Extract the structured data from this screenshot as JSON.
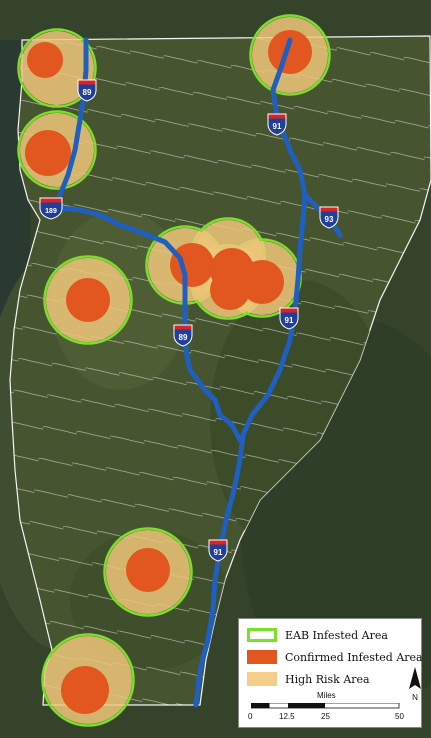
{
  "map": {
    "colors": {
      "background": "#3b4a2c",
      "state_fill": "#4a5a34",
      "town_lines": "#f2f2f2",
      "highway": "#1f5fbf",
      "highway_in_risk": "#9aa0a8",
      "confirmed": "#e2571f",
      "high_risk": "#f0c77a",
      "eab_border": "#7be02a"
    },
    "interstate_shields": [
      {
        "id": "shield-89-north",
        "number": "89"
      },
      {
        "id": "shield-91-north",
        "number": "91"
      },
      {
        "id": "shield-189",
        "number": "189"
      },
      {
        "id": "shield-93",
        "number": "93"
      },
      {
        "id": "shield-89-central",
        "number": "89"
      },
      {
        "id": "shield-91-central",
        "number": "91"
      },
      {
        "id": "shield-91-south",
        "number": "91"
      }
    ]
  },
  "legend": {
    "items": [
      {
        "label": "EAB Infested Area",
        "swatch": "eab"
      },
      {
        "label": "Confirmed Infested Area",
        "swatch": "confirmed"
      },
      {
        "label": "High Risk Area",
        "swatch": "risk"
      }
    ]
  },
  "scale_bar": {
    "title": "Miles",
    "ticks": [
      "0",
      "12.5",
      "25",
      "50"
    ]
  },
  "north_arrow": {
    "label": "N"
  }
}
